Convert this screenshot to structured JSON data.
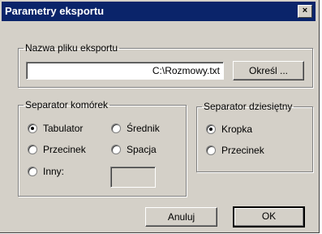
{
  "window": {
    "title": "Parametry eksportu",
    "close_label": "×"
  },
  "file_group": {
    "legend": "Nazwa pliku eksportu",
    "value": "C:\\Rozmowy.txt",
    "browse_label": "Określ ..."
  },
  "cell_sep": {
    "legend": "Separator komórek",
    "options": {
      "tab": "Tabulator",
      "semicolon": "Średnik",
      "comma": "Przecinek",
      "space": "Spacja",
      "other": "Inny:"
    },
    "selected": "Tabulator",
    "other_value": ""
  },
  "dec_sep": {
    "legend": "Separator dziesiętny",
    "options": {
      "dot": "Kropka",
      "comma": "Przecinek"
    },
    "selected": "Kropka"
  },
  "buttons": {
    "cancel": "Anuluj",
    "ok": "OK"
  }
}
